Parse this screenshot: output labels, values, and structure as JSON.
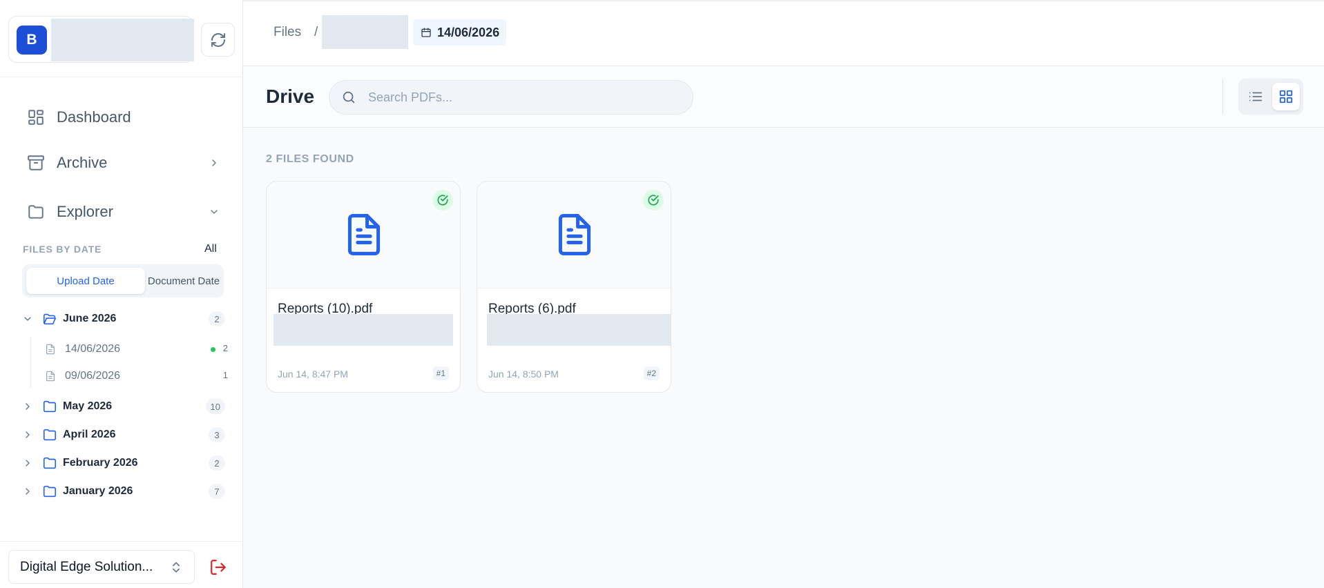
{
  "sidebar": {
    "workspace": {
      "avatar_letter": "B"
    },
    "nav": {
      "dashboard": "Dashboard",
      "archive": "Archive",
      "explorer": "Explorer"
    },
    "files_by_date": {
      "label": "FILES BY DATE",
      "all_link": "All",
      "tabs": {
        "upload_date": "Upload Date",
        "document_date": "Document Date"
      },
      "active_tab": "Upload Date"
    },
    "tree": [
      {
        "label": "June 2026",
        "count": "2",
        "expanded": true,
        "children": [
          {
            "label": "14/06/2026",
            "count": "2",
            "active": true
          },
          {
            "label": "09/06/2026",
            "count": "1",
            "active": false
          }
        ]
      },
      {
        "label": "May 2026",
        "count": "10",
        "expanded": false
      },
      {
        "label": "April 2026",
        "count": "3",
        "expanded": false
      },
      {
        "label": "February 2026",
        "count": "2",
        "expanded": false
      },
      {
        "label": "January 2026",
        "count": "7",
        "expanded": false
      }
    ],
    "org_selector": "Digital Edge Solution..."
  },
  "topbar": {
    "breadcrumb_root": "Files",
    "breadcrumb_sep": "/",
    "date_chip": "14/06/2026"
  },
  "subheader": {
    "title": "Drive",
    "search_placeholder": "Search PDFs...",
    "view_mode": "grid"
  },
  "content": {
    "files_found": "2 FILES FOUND",
    "files": [
      {
        "name": "Reports (10).pdf",
        "date": "Jun 14, 8:47 PM",
        "index": "#1",
        "status": "processed"
      },
      {
        "name": "Reports (6).pdf",
        "date": "Jun 14, 8:50 PM",
        "index": "#2",
        "status": "processed"
      }
    ]
  },
  "colors": {
    "accent": "#2563eb",
    "avatar_bg": "#1d4ed8",
    "success": "#16a34a",
    "danger": "#dc2626"
  }
}
